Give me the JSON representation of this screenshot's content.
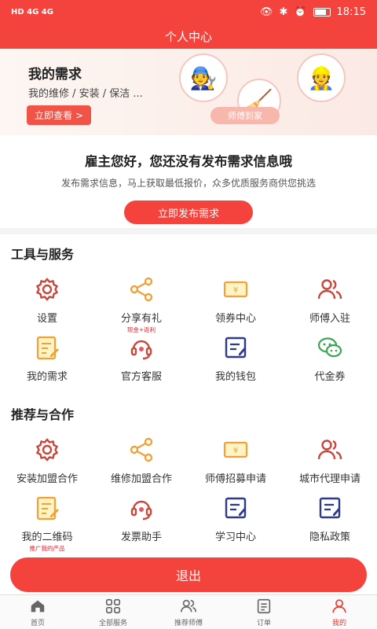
{
  "status_bar": {
    "left": "HD 4G 4G",
    "time": "18:15"
  },
  "header": {
    "title": "个人中心"
  },
  "banner": {
    "title": "我的需求",
    "subtitle": "我的维修 / 安装 / 保洁 ...",
    "button": "立即查看 >",
    "ribbon": "师傅到家"
  },
  "notice": {
    "title": "雇主您好，您还没有发布需求信息哦",
    "subtitle": "发布需求信息，马上获取最低报价，众多优质服务商供您挑选",
    "button": "立即发布需求"
  },
  "tools": {
    "title": "工具与服务",
    "items": [
      {
        "label": "设置",
        "icon": "gear-icon"
      },
      {
        "label": "分享有礼",
        "tag": "现金+返利",
        "icon": "share-icon"
      },
      {
        "label": "领券中心",
        "icon": "coupon-icon"
      },
      {
        "label": "师傅入驻",
        "icon": "users-icon"
      },
      {
        "label": "我的需求",
        "icon": "edit-doc-icon"
      },
      {
        "label": "官方客服",
        "icon": "headset-icon"
      },
      {
        "label": "我的钱包",
        "icon": "wallet-icon"
      },
      {
        "label": "代金券",
        "icon": "wechat-icon"
      }
    ]
  },
  "coop": {
    "title": "推荐与合作",
    "items": [
      {
        "label": "安装加盟合作",
        "icon": "gear-icon"
      },
      {
        "label": "维修加盟合作",
        "icon": "share-icon"
      },
      {
        "label": "师傅招募申请",
        "icon": "coupon-icon"
      },
      {
        "label": "城市代理申请",
        "icon": "users-icon"
      },
      {
        "label": "我的二维码",
        "tag": "推广我的产品",
        "icon": "edit-doc-icon"
      },
      {
        "label": "发票助手",
        "icon": "headset-icon"
      },
      {
        "label": "学习中心",
        "icon": "wallet-icon"
      },
      {
        "label": "隐私政策",
        "icon": "wallet-icon"
      }
    ]
  },
  "logout": {
    "label": "退出"
  },
  "tabbar": {
    "tabs": [
      {
        "label": "首页",
        "icon": "home-icon"
      },
      {
        "label": "全部服务",
        "icon": "grid-icon"
      },
      {
        "label": "推荐师傅",
        "icon": "users-icon"
      },
      {
        "label": "订单",
        "icon": "order-icon"
      },
      {
        "label": "我的",
        "icon": "person-icon"
      }
    ],
    "active": "我的"
  },
  "colors": {
    "primary": "#f4433c",
    "icon_red": "#c9463a",
    "icon_orange": "#f0a23a",
    "icon_navy": "#2e3a8c",
    "icon_green": "#3aa655",
    "icon_pink": "#e15a66"
  }
}
